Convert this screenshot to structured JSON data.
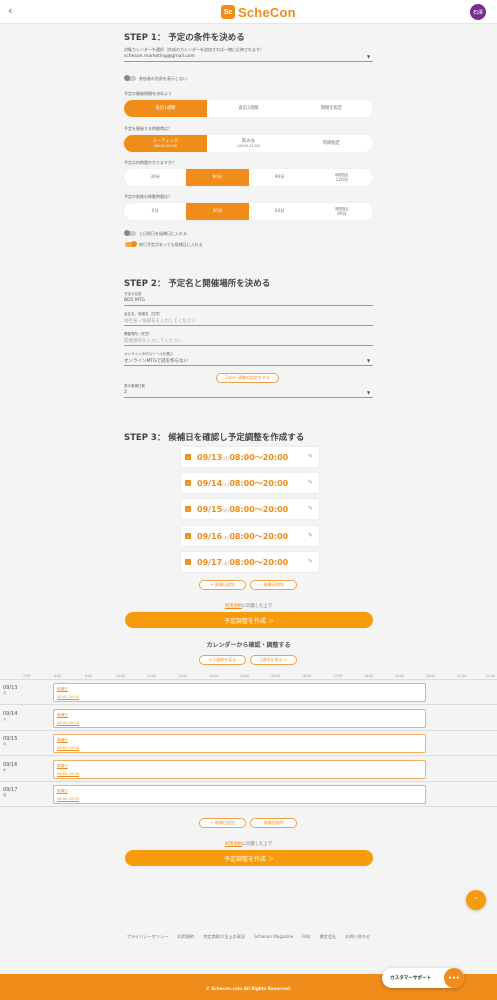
{
  "header": {
    "back_icon": "chevron-left-icon",
    "logo_mark": "Sc",
    "logo_text": "ScheCon",
    "avatar_text": "石澤"
  },
  "step1": {
    "title": "STEP 1： 予定の条件を決める",
    "calendar_label": "対象カレンダーを選択（作成のカレンダーを追加すれば一緒に反映されます）",
    "calendar_value": "schecon.marketing@gmail.com",
    "show_attendee_label": "参加者の名前を表示しない",
    "period_label": "予定の開催期間を決めよう",
    "period_options": [
      "直近1週間",
      "直近2週間",
      "期間を指定"
    ],
    "time_label": "予定を開催する時間帯は？",
    "time_options": [
      {
        "main": "ミーティング",
        "sub": "(08:00-20:00)"
      },
      {
        "main": "飲み会",
        "sub": "(18:00-23:00)"
      },
      {
        "main": "時間指定",
        "sub": ""
      }
    ],
    "duration_label": "予定は何時間かかりますか？",
    "duration_options": [
      "30分",
      "60分",
      "90分",
      "120分"
    ],
    "duration_custom_label": "時間指定",
    "travel_label": "予定の前後の移動時間は？",
    "travel_options": [
      "0分",
      "30分",
      "60分",
      "90分"
    ],
    "travel_custom_label": "時間指定",
    "holiday_label": "土日祝日を候補日に入れる",
    "allday_label": "終日予定があっても候補日に入れる"
  },
  "step2": {
    "title": "STEP 2： 予定名と開催場所を決める",
    "name_label": "予定の名前",
    "name_value": "BD5 MTG",
    "company_label": "会社名、候補名（任意）",
    "company_placeholder": "会社名・候補名を入力してください",
    "place_label": "開催場所（任意）",
    "place_placeholder": "開催場所を入力してください",
    "online_label": "オンライン(MTG)ツールを選ぶ",
    "online_value": "オンラインMTGで話を作らない",
    "zoom_button": "Zoom 連携の設定をする",
    "count_label": "表示候補日数",
    "count_value": "2"
  },
  "step3": {
    "title": "STEP 3： 候補日を確認し予定調整を作成する",
    "candidates": [
      {
        "date": "09/13",
        "dow": "(月)",
        "time": "08:00～20:00"
      },
      {
        "date": "09/14",
        "dow": "(火)",
        "time": "08:00～20:00"
      },
      {
        "date": "09/15",
        "dow": "(水)",
        "time": "08:00～20:00"
      },
      {
        "date": "09/16",
        "dow": "(木)",
        "time": "08:00～20:00"
      },
      {
        "date": "09/17",
        "dow": "(金)",
        "time": "08:00～20:00"
      }
    ],
    "add_button": "+ 候補日追加",
    "delete_button": "候補日削除",
    "terms_link": "利用規約",
    "terms_suffix": "に同意した上で",
    "create_button": "予定調整を作成 ＞",
    "calendar_title": "カレンダーから確認・調整する",
    "prev_week": "< 1週前を見る",
    "next_week": "1週次を見る >"
  },
  "calendar": {
    "hours": [
      "7:00",
      "8:00",
      "9:00",
      "10:00",
      "11:00",
      "12:00",
      "13:00",
      "14:00",
      "15:00",
      "16:00",
      "17:00",
      "18:00",
      "19:00",
      "20:00",
      "21:00",
      "22:00"
    ],
    "rows": [
      {
        "date": "09/13",
        "dow": "月",
        "title": "候補日",
        "time": "08:00-20:00"
      },
      {
        "date": "09/14",
        "dow": "火",
        "title": "候補日",
        "time": "08:00-20:00"
      },
      {
        "date": "09/15",
        "dow": "水",
        "title": "候補日",
        "time": "08:00-20:00"
      },
      {
        "date": "09/16",
        "dow": "木",
        "title": "候補日",
        "time": "08:00-20:00"
      },
      {
        "date": "09/17",
        "dow": "金",
        "title": "候補日",
        "time": "08:00-20:00"
      }
    ],
    "add_button": "+ 候補日追加",
    "delete_button": "候補日削除",
    "terms_link": "利用規約",
    "terms_suffix": "に同意した上で",
    "create_button": "予定調整を作成 ＞"
  },
  "footer": {
    "links": [
      "プライバシーポリシー",
      "利用規約",
      "特定商取引法上の表記",
      "Schecon Magazine",
      "FAQ",
      "運営会社",
      "お問い合わせ"
    ],
    "copyright": "© Schecon.com All Rights Reserved.",
    "support_label": "カスタマーサポート",
    "scroll_top_icon": "chevron-up-icon",
    "chat_icon": "chat-bubble-icon"
  },
  "colors": {
    "accent": "#f08c1a",
    "accent_light": "#f79a0c",
    "background": "#f4f4f4"
  }
}
